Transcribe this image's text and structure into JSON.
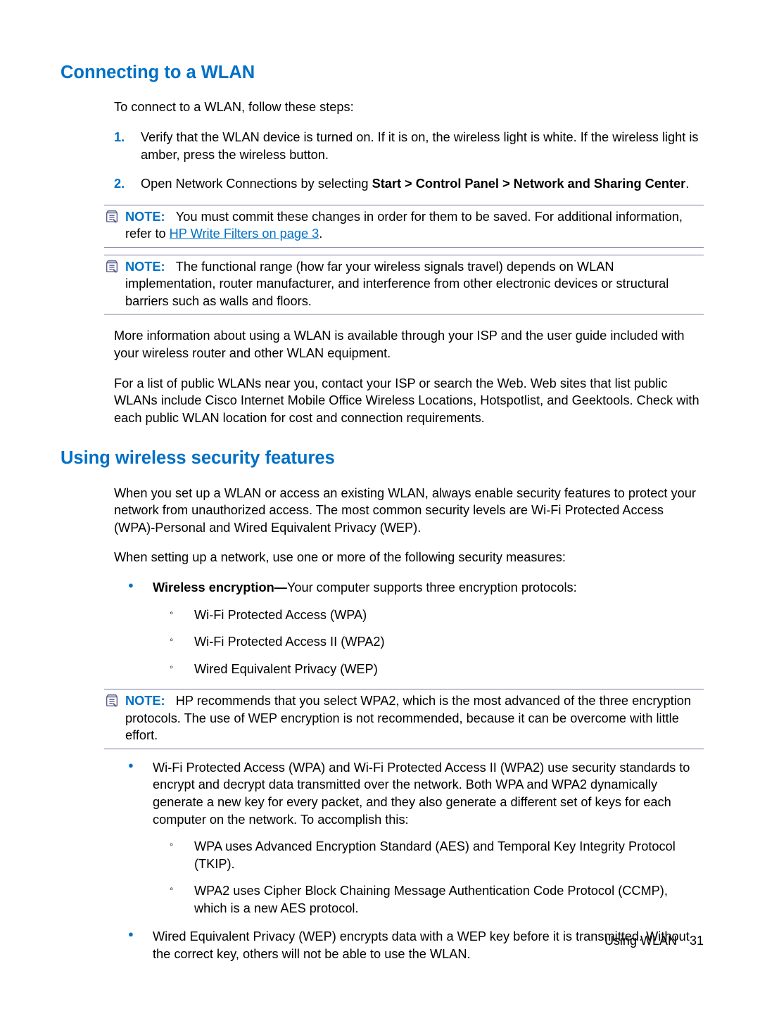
{
  "section1": {
    "heading": "Connecting to a WLAN",
    "intro": "To connect to a WLAN, follow these steps:",
    "steps": [
      {
        "num": "1.",
        "body": "Verify that the WLAN device is turned on. If it is on, the wireless light is white. If the wireless light is amber, press the wireless button."
      },
      {
        "num": "2.",
        "pre": "Open Network Connections by selecting ",
        "bold": "Start > Control Panel > Network and Sharing Center",
        "post": "."
      }
    ],
    "note1": {
      "label": "NOTE:",
      "text": "You must commit these changes in order for them to be saved. For additional information, refer to ",
      "link": "HP Write Filters on page 3",
      "after": "."
    },
    "note2": {
      "label": "NOTE:",
      "text": "The functional range (how far your wireless signals travel) depends on WLAN implementation, router manufacturer, and interference from other electronic devices or structural barriers such as walls and floors."
    },
    "para1": "More information about using a WLAN is available through your ISP and the user guide included with your wireless router and other WLAN equipment.",
    "para2": "For a list of public WLANs near you, contact your ISP or search the Web. Web sites that list public WLANs include Cisco Internet Mobile Office Wireless Locations, Hotspotlist, and Geektools. Check with each public WLAN location for cost and connection requirements."
  },
  "section2": {
    "heading": "Using wireless security features",
    "para1": "When you set up a WLAN or access an existing WLAN, always enable security features to protect your network from unauthorized access. The most common security levels are Wi-Fi Protected Access (WPA)-Personal and Wired Equivalent Privacy (WEP).",
    "para2": "When setting up a network, use one or more of the following security measures:",
    "b1_bold": "Wireless encryption—",
    "b1_rest": "Your computer supports three encryption protocols:",
    "sb1": "Wi-Fi Protected Access (WPA)",
    "sb2": "Wi-Fi Protected Access II (WPA2)",
    "sb3": "Wired Equivalent Privacy (WEP)",
    "note3": {
      "label": "NOTE:",
      "text": "HP recommends that you select WPA2, which is the most advanced of the three encryption protocols. The use of WEP encryption is not recommended, because it can be overcome with little effort."
    },
    "b2": "Wi-Fi Protected Access (WPA) and Wi-Fi Protected Access II (WPA2) use security standards to encrypt and decrypt data transmitted over the network. Both WPA and WPA2 dynamically generate a new key for every packet, and they also generate a different set of keys for each computer on the network. To accomplish this:",
    "b2_s1": "WPA uses Advanced Encryption Standard (AES) and Temporal Key Integrity Protocol (TKIP).",
    "b2_s2": "WPA2 uses Cipher Block Chaining Message Authentication Code Protocol (CCMP), which is a new AES protocol.",
    "b3": "Wired Equivalent Privacy (WEP) encrypts data with a WEP key before it is transmitted. Without the correct key, others will not be able to use the WLAN."
  },
  "footer": {
    "section": "Using WLAN",
    "page": "31"
  }
}
